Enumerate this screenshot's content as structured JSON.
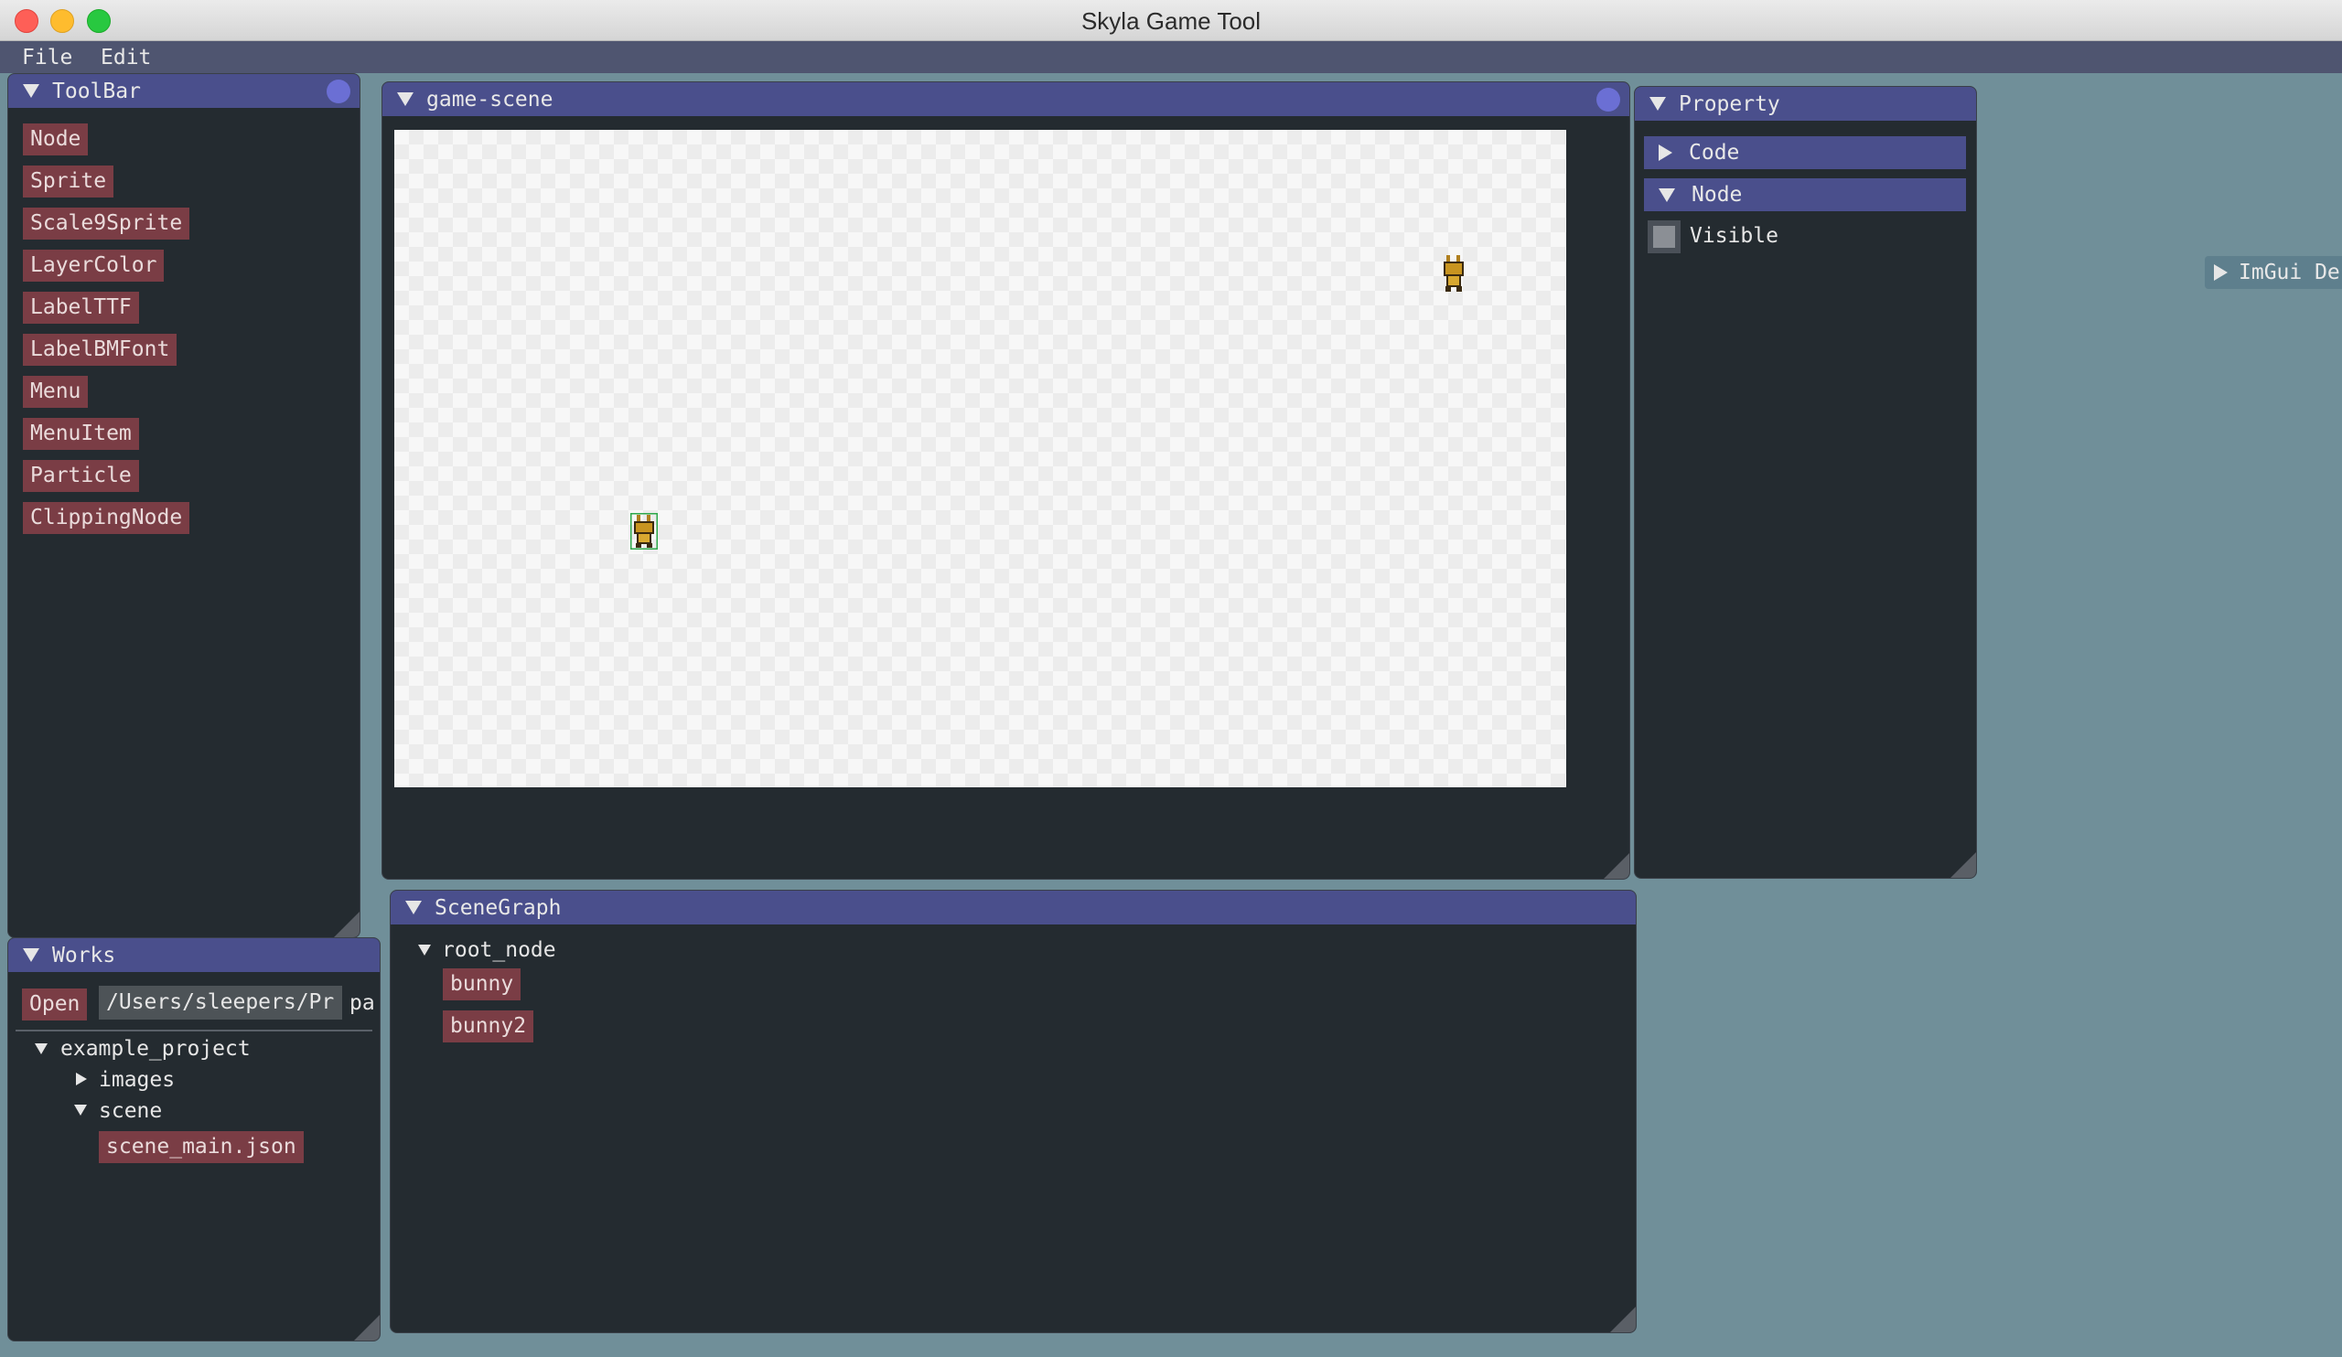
{
  "window": {
    "title": "Skyla Game Tool"
  },
  "menu": {
    "items": [
      "File",
      "Edit"
    ]
  },
  "toolbar": {
    "title": "ToolBar",
    "buttons": [
      "Node",
      "Sprite",
      "Scale9Sprite",
      "LayerColor",
      "LabelTTF",
      "LabelBMFont",
      "Menu",
      "MenuItem",
      "Particle",
      "ClippingNode"
    ]
  },
  "game_scene": {
    "title": "game-scene"
  },
  "property": {
    "title": "Property",
    "sections": [
      "Code",
      "Node"
    ],
    "visible_label": "Visible"
  },
  "imgui_demo": {
    "label": "ImGui De"
  },
  "works": {
    "title": "Works",
    "open_label": "Open",
    "path_value": "/Users/sleepers/Pr",
    "path_suffix": "pa",
    "tree": {
      "project": "example_project",
      "folders": [
        "images",
        "scene"
      ],
      "file": "scene_main.json"
    }
  },
  "scenegraph": {
    "title": "SceneGraph",
    "root": "root_node",
    "children": [
      "bunny",
      "bunny2"
    ]
  },
  "colors": {
    "background": "#708f99",
    "panel": "#242b30",
    "header": "#4a4f8c",
    "button": "#7a3d45"
  }
}
